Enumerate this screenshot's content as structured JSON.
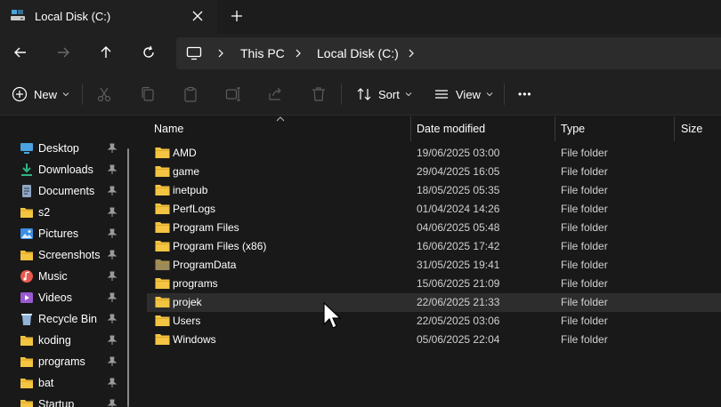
{
  "window": {
    "tab_title": "Local Disk (C:)",
    "tab_icon": "drive-icon"
  },
  "nav": {
    "back_icon": "arrow-left-icon",
    "forward_icon": "arrow-right-icon",
    "up_icon": "arrow-up-icon",
    "refresh_icon": "refresh-icon"
  },
  "address": {
    "crumbs": [
      "This PC",
      "Local Disk (C:)"
    ]
  },
  "toolbar": {
    "new_label": "New",
    "sort_label": "Sort",
    "view_label": "View",
    "more_label": "•••"
  },
  "sidebar": {
    "items": [
      {
        "label": "Desktop",
        "icon": "desktop-icon",
        "color": "#4aa3df"
      },
      {
        "label": "Downloads",
        "icon": "download-icon",
        "color": "#2fb583"
      },
      {
        "label": "Documents",
        "icon": "document-icon",
        "color": "#8fa7c4"
      },
      {
        "label": "s2",
        "icon": "folder-icon",
        "color": "#f4c542"
      },
      {
        "label": "Pictures",
        "icon": "pictures-icon",
        "color": "#3b8ee8"
      },
      {
        "label": "Screenshots",
        "icon": "folder-icon",
        "color": "#f4c542"
      },
      {
        "label": "Music",
        "icon": "music-icon",
        "color": "#e8584f"
      },
      {
        "label": "Videos",
        "icon": "videos-icon",
        "color": "#9b59d0"
      },
      {
        "label": "Recycle Bin",
        "icon": "recycle-bin-icon",
        "color": "#8fb4d8"
      },
      {
        "label": "koding",
        "icon": "folder-icon",
        "color": "#f4c542"
      },
      {
        "label": "programs",
        "icon": "folder-icon",
        "color": "#f4c542"
      },
      {
        "label": "bat",
        "icon": "folder-icon",
        "color": "#f4c542"
      },
      {
        "label": "Startup",
        "icon": "folder-icon",
        "color": "#f4c542"
      }
    ]
  },
  "table": {
    "columns": {
      "name": "Name",
      "date": "Date modified",
      "type": "Type",
      "size": "Size"
    },
    "rows": [
      {
        "name": "AMD",
        "date": "19/06/2025 03:00",
        "type": "File folder"
      },
      {
        "name": "game",
        "date": "29/04/2025 16:05",
        "type": "File folder"
      },
      {
        "name": "inetpub",
        "date": "18/05/2025 05:35",
        "type": "File folder"
      },
      {
        "name": "PerfLogs",
        "date": "01/04/2024 14:26",
        "type": "File folder"
      },
      {
        "name": "Program Files",
        "date": "04/06/2025 05:48",
        "type": "File folder"
      },
      {
        "name": "Program Files (x86)",
        "date": "16/06/2025 17:42",
        "type": "File folder"
      },
      {
        "name": "ProgramData",
        "date": "31/05/2025 19:41",
        "type": "File folder"
      },
      {
        "name": "programs",
        "date": "15/06/2025 21:09",
        "type": "File folder"
      },
      {
        "name": "projek",
        "date": "22/06/2025 21:33",
        "type": "File folder"
      },
      {
        "name": "Users",
        "date": "22/05/2025 03:06",
        "type": "File folder"
      },
      {
        "name": "Windows",
        "date": "05/06/2025 22:04",
        "type": "File folder"
      }
    ]
  },
  "colors": {
    "folder": "#f4c542",
    "folder_hidden": "#9c8a5a",
    "hover_row": "#2d2d2d"
  }
}
